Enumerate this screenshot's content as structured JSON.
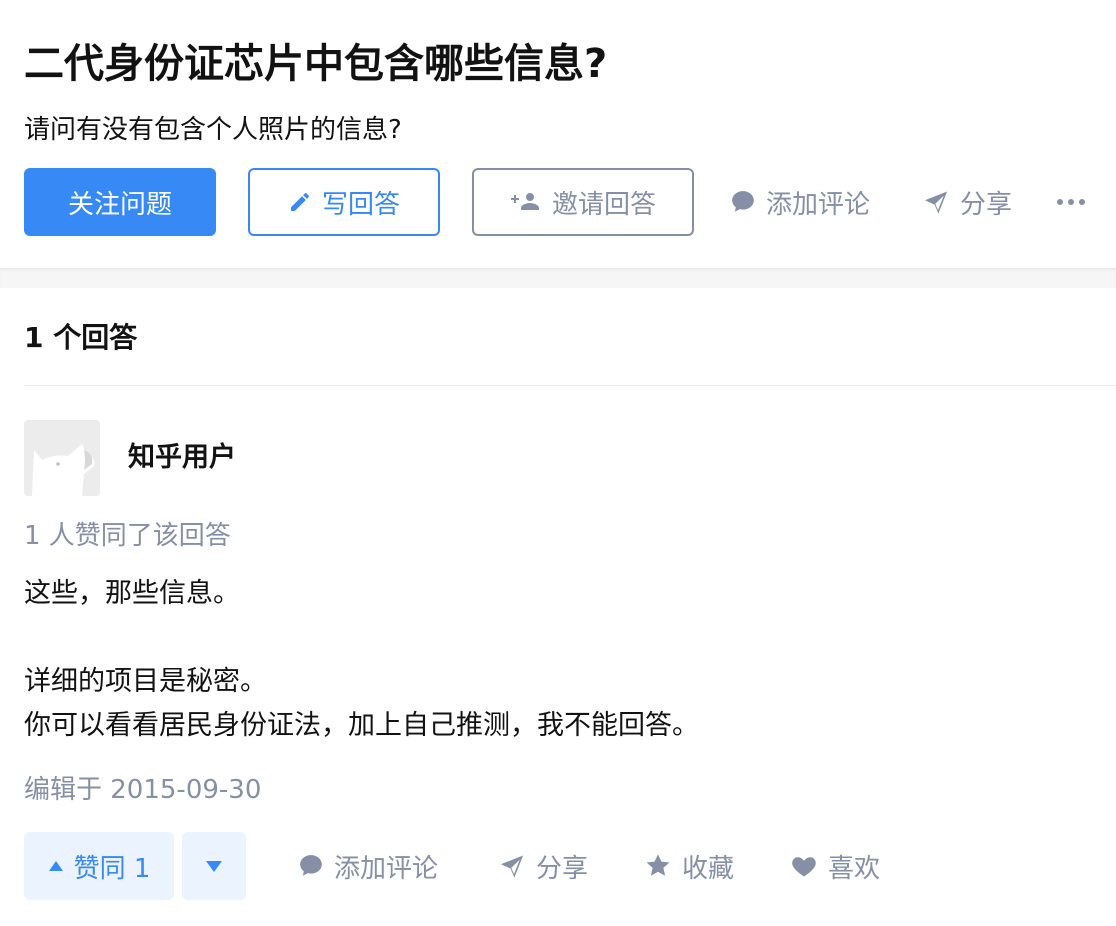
{
  "question": {
    "title": "二代身份证芯片中包含哪些信息?",
    "detail": "请问有没有包含个人照片的信息?"
  },
  "question_actions": {
    "follow_label": "关注问题",
    "write_label": "写回答",
    "invite_label": "邀请回答",
    "comment_label": "添加评论",
    "share_label": "分享",
    "more_icon": "more-icon"
  },
  "answers": {
    "count_label": "1 个回答"
  },
  "answer": {
    "author_name": "知乎用户",
    "voters_text": "1 人赞同了该回答",
    "paragraphs": [
      "这些，那些信息。",
      "详细的项目是秘密。",
      "你可以看看居民身份证法，加上自己推测，我不能回答。"
    ],
    "edited_text": "编辑于 2015-09-30",
    "upvote_label": "赞同 1",
    "comment_label": "添加评论",
    "share_label": "分享",
    "favorite_label": "收藏",
    "like_label": "喜欢"
  },
  "colors": {
    "brand_blue": "#3789f5",
    "muted_gray": "#8590a6",
    "vote_bg": "#ebf3ff",
    "text": "#121212"
  }
}
